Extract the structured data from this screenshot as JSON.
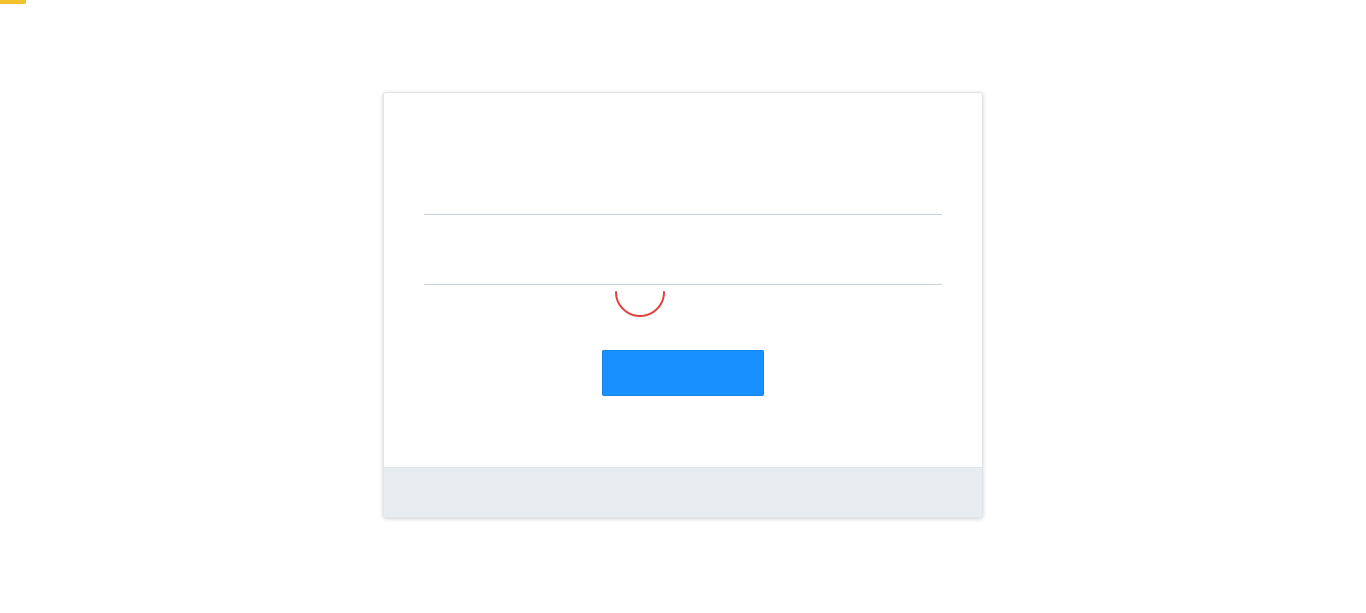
{
  "login": {
    "username": {
      "value": "",
      "placeholder": ""
    },
    "password": {
      "value": "",
      "placeholder": ""
    },
    "submit_label": "",
    "footer_text": ""
  },
  "colors": {
    "accent": "#1890ff",
    "spinner": "#e0413d",
    "footer": "#e7ecf1",
    "corner_tab": "#f2c12e"
  },
  "icons": {
    "loading": "loading-spinner-icon"
  }
}
